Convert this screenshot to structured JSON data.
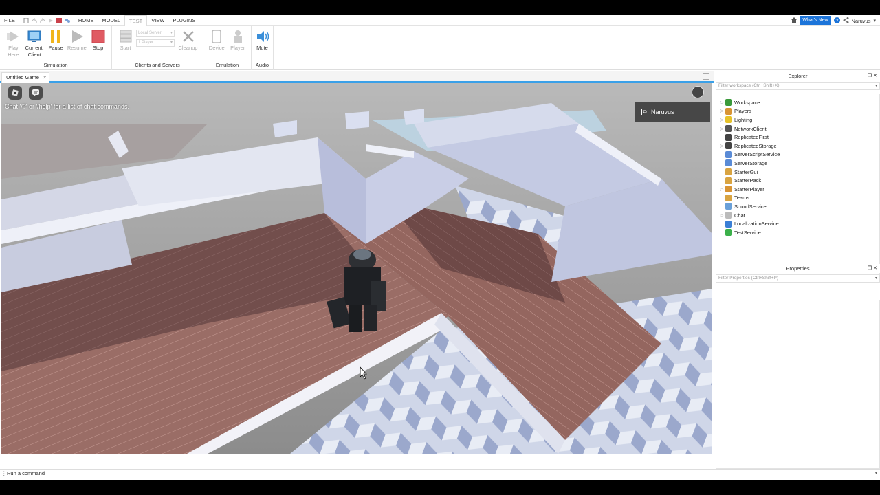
{
  "menubar": {
    "items": [
      "FILE",
      "HOME",
      "MODEL",
      "TEST",
      "VIEW",
      "PLUGINS"
    ],
    "whats_new": "What's New",
    "username": "Naruvus"
  },
  "ribbon": {
    "simulation": {
      "label": "Simulation",
      "play_here": "Play\nHere",
      "current_client": "Current:\nClient",
      "pause": "Pause",
      "resume": "Resume",
      "stop": "Stop"
    },
    "clients_servers": {
      "label": "Clients and Servers",
      "server_select": "Local Server",
      "player_select": "1 Player",
      "start": "Start",
      "cleanup": "Cleanup"
    },
    "emulation": {
      "label": "Emulation",
      "device": "Device",
      "player": "Player"
    },
    "audio": {
      "label": "Audio",
      "mute": "Mute"
    }
  },
  "document_tab": {
    "title": "Untitled Game",
    "close": "×"
  },
  "viewport": {
    "chat_hint": "Chat '/?' or '/help' for a list of chat commands.",
    "player_name": "Naruvus",
    "more": "···"
  },
  "explorer": {
    "title": "Explorer",
    "filter_placeholder": "Filter workspace (Ctrl+Shift+X)",
    "items": [
      {
        "name": "Workspace",
        "expandable": true,
        "color": "#3b9a3b"
      },
      {
        "name": "Players",
        "expandable": true,
        "color": "#d89434"
      },
      {
        "name": "Lighting",
        "expandable": true,
        "color": "#e6c229"
      },
      {
        "name": "NetworkClient",
        "expandable": true,
        "color": "#555555"
      },
      {
        "name": "ReplicatedFirst",
        "expandable": false,
        "color": "#444444"
      },
      {
        "name": "ReplicatedStorage",
        "expandable": true,
        "color": "#444444"
      },
      {
        "name": "ServerScriptService",
        "expandable": false,
        "color": "#5a8bd6"
      },
      {
        "name": "ServerStorage",
        "expandable": false,
        "color": "#5a8bd6"
      },
      {
        "name": "StarterGui",
        "expandable": false,
        "color": "#d9a441"
      },
      {
        "name": "StarterPack",
        "expandable": false,
        "color": "#d9a441"
      },
      {
        "name": "StarterPlayer",
        "expandable": true,
        "color": "#d89434"
      },
      {
        "name": "Teams",
        "expandable": false,
        "color": "#d9a441"
      },
      {
        "name": "SoundService",
        "expandable": false,
        "color": "#6aa0d8"
      },
      {
        "name": "Chat",
        "expandable": true,
        "color": "#bbbbbb"
      },
      {
        "name": "LocalizationService",
        "expandable": false,
        "color": "#3b7fd6"
      },
      {
        "name": "TestService",
        "expandable": false,
        "color": "#3bb04a"
      }
    ]
  },
  "properties": {
    "title": "Properties",
    "filter_placeholder": "Filter Properties (Ctrl+Shift+P)"
  },
  "command_bar": {
    "placeholder": "Run a command"
  },
  "colors": {
    "accent": "#1c74d9",
    "tab_underline": "#3aa0e8"
  }
}
